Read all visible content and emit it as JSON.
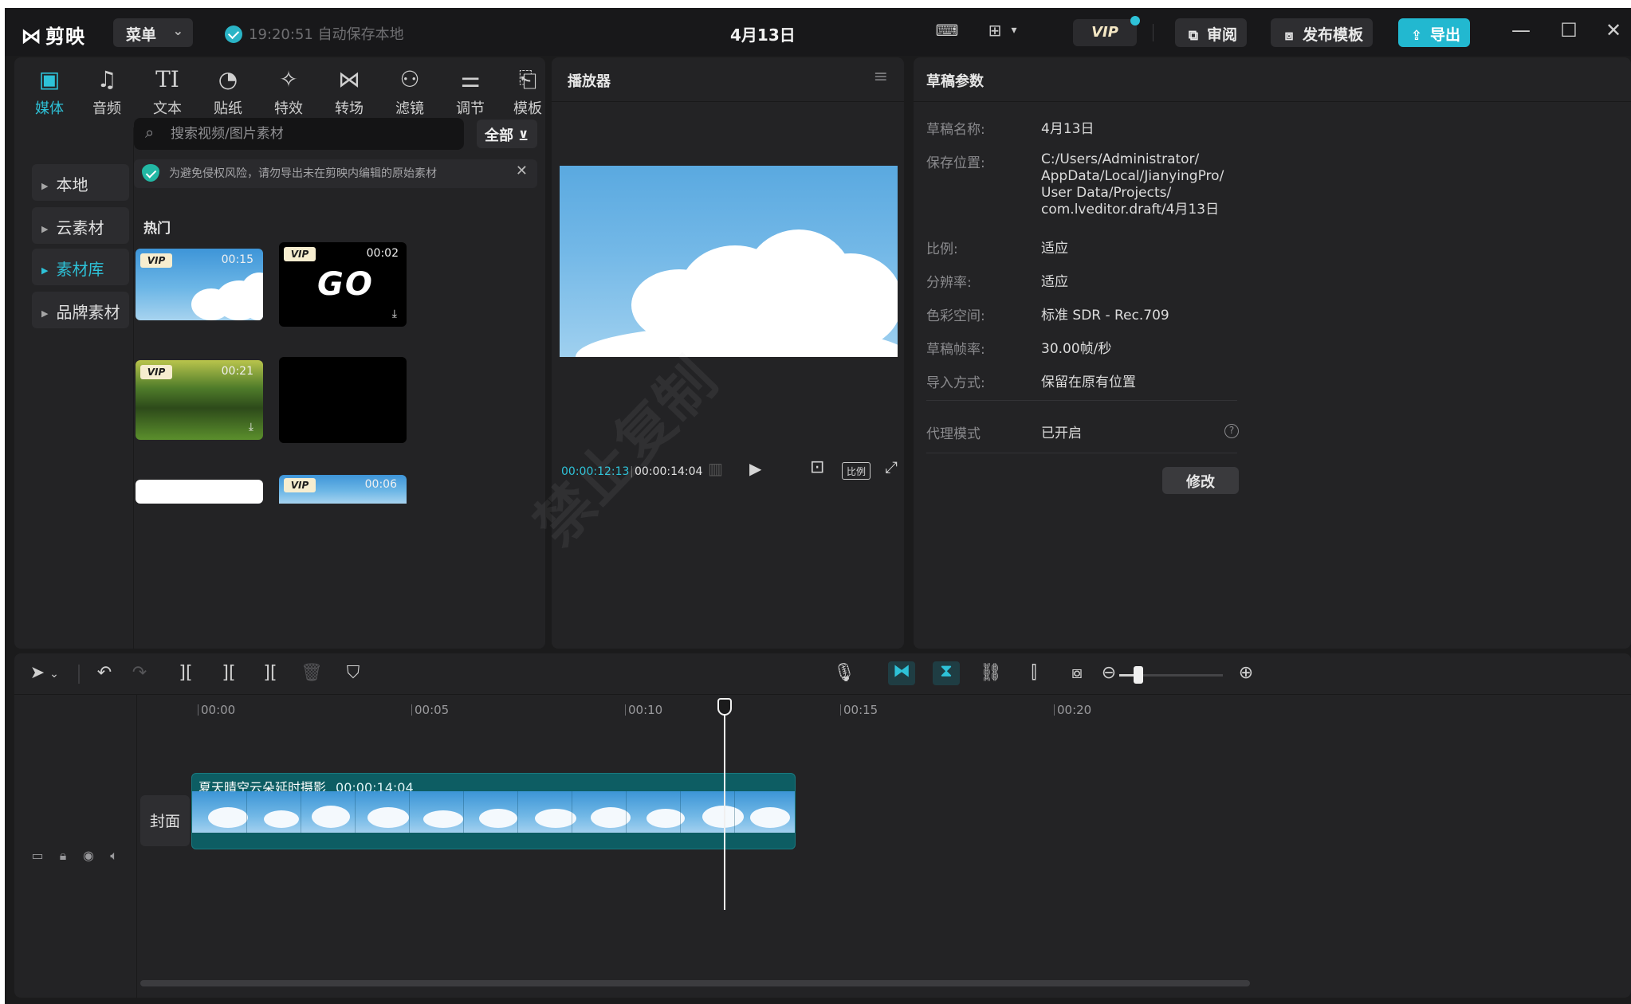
{
  "titlebar": {
    "app_name": "剪映",
    "menu_label": "菜单",
    "autosave_text": "19:20:51 自动保存本地",
    "project_title": "4月13日",
    "vip_label": "VIP",
    "review_label": "审阅",
    "publish_template_label": "发布模板",
    "export_label": "导出"
  },
  "media": {
    "tabs": [
      {
        "label": "媒体",
        "icon": "media-icon",
        "glyph": "▣"
      },
      {
        "label": "音频",
        "icon": "audio-icon",
        "glyph": "♫"
      },
      {
        "label": "文本",
        "icon": "text-icon",
        "glyph": "TI"
      },
      {
        "label": "贴纸",
        "icon": "sticker-icon",
        "glyph": "◔"
      },
      {
        "label": "特效",
        "icon": "effects-icon",
        "glyph": "✧"
      },
      {
        "label": "转场",
        "icon": "transition-icon",
        "glyph": "⋈"
      },
      {
        "label": "滤镜",
        "icon": "filter-icon",
        "glyph": "⚇"
      },
      {
        "label": "调节",
        "icon": "adjust-icon",
        "glyph": "⚌"
      },
      {
        "label": "模板",
        "icon": "template-icon",
        "glyph": "⎗"
      }
    ],
    "nav": [
      {
        "label": "本地"
      },
      {
        "label": "云素材"
      },
      {
        "label": "素材库"
      },
      {
        "label": "品牌素材"
      }
    ],
    "search_placeholder": "搜索视频/图片素材",
    "filter_label": "全部",
    "notice_text": "为避免侵权风险，请勿导出未在剪映内编辑的原始素材",
    "hot_label": "热门",
    "thumbs": [
      {
        "vip": "VIP",
        "duration": "00:15"
      },
      {
        "vip": "VIP",
        "duration": "00:02",
        "title": "GO"
      },
      {
        "vip": "VIP",
        "duration": "00:21"
      },
      {
        "vip": "",
        "duration": ""
      },
      {
        "vip": "",
        "duration": ""
      },
      {
        "vip": "VIP",
        "duration": "00:06"
      }
    ]
  },
  "player": {
    "title": "播放器",
    "current_time": "00:00:12:13",
    "total_time": "00:00:14:04",
    "ratio_label": "比例"
  },
  "props": {
    "title": "草稿参数",
    "rows": [
      {
        "key": "草稿名称:",
        "value": "4月13日"
      },
      {
        "key": "保存位置:",
        "value": "C:/Users/Administrator/\nAppData/Local/JianyingPro/\nUser Data/Projects/\ncom.lveditor.draft/4月13日"
      },
      {
        "key": "比例:",
        "value": "适应"
      },
      {
        "key": "分辨率:",
        "value": "适应"
      },
      {
        "key": "色彩空间:",
        "value": "标准 SDR - Rec.709"
      },
      {
        "key": "草稿帧率:",
        "value": "30.00帧/秒"
      },
      {
        "key": "导入方式:",
        "value": "保留在原有位置"
      },
      {
        "key": "代理模式",
        "value": "已开启"
      }
    ],
    "modify_label": "修改"
  },
  "timeline": {
    "ticks": [
      "00:00",
      "00:05",
      "00:10",
      "00:15",
      "00:20"
    ],
    "cover_label": "封面",
    "clip_title": "夏天晴空云朵延时摄影",
    "clip_duration": "00:00:14:04"
  },
  "colors": {
    "accent": "#2ec2d8",
    "background": "#1b1b1c",
    "panel": "#232325",
    "clip": "#0d5d63"
  }
}
